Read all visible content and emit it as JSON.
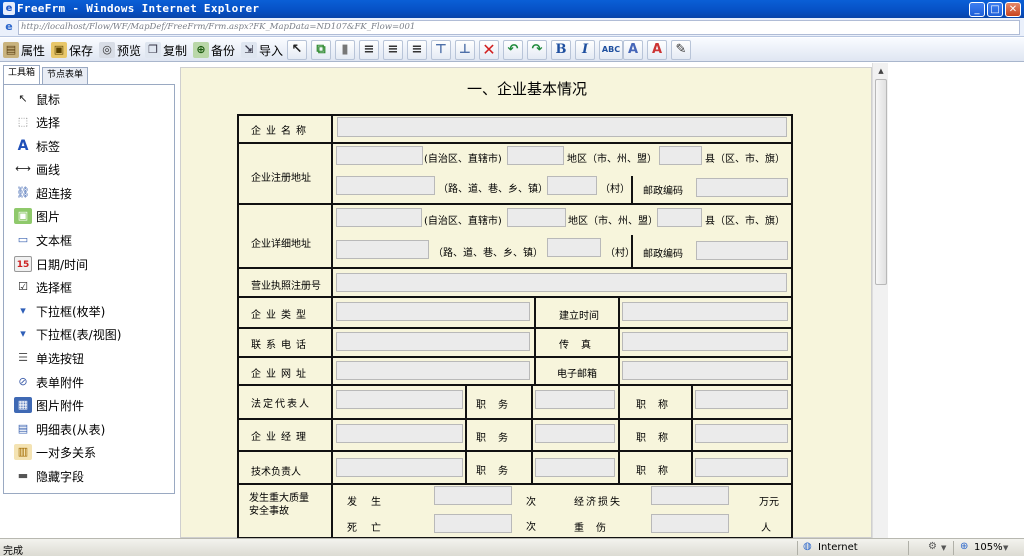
{
  "window": {
    "title": "FreeFrm - Windows Internet Explorer",
    "app_icon": "ie-icon",
    "buttons": {
      "minimize": "_",
      "maximize": "□",
      "close": "✕"
    }
  },
  "address": {
    "url": "http://localhost/Flow/WF/MapDef/FreeFrm/Frm.aspx?FK_MapData=ND107&FK_Flow=001"
  },
  "toolbar": {
    "properties": "属性",
    "save": "保存",
    "preview": "预览",
    "copy": "复制",
    "backup": "备份",
    "import": "导入",
    "icons": [
      "pointer-icon",
      "copy-format-icon",
      "paste-format-icon",
      "align-left-icon",
      "align-center-icon",
      "align-right-icon",
      "align-top-icon",
      "align-bottom-icon",
      "delete-icon",
      "undo-icon",
      "redo-icon",
      "bold-icon",
      "italic-icon",
      "font-icon",
      "font-color-icon",
      "fill-color-icon",
      "settings-icon"
    ]
  },
  "tabs": [
    "工具箱",
    "节点表单"
  ],
  "tools": [
    {
      "label": "鼠标",
      "icon": "cursor-icon"
    },
    {
      "label": "选择",
      "icon": "select-icon"
    },
    {
      "label": "标签",
      "icon": "label-icon"
    },
    {
      "label": "画线",
      "icon": "line-icon"
    },
    {
      "label": "超连接",
      "icon": "link-icon"
    },
    {
      "label": "图片",
      "icon": "image-icon"
    },
    {
      "label": "文本框",
      "icon": "textbox-icon"
    },
    {
      "label": "日期/时间",
      "icon": "calendar-icon"
    },
    {
      "label": "选择框",
      "icon": "checkbox-icon"
    },
    {
      "label": "下拉框(枚举)",
      "icon": "dropdown-icon"
    },
    {
      "label": "下拉框(表/视图)",
      "icon": "dropdown-table-icon"
    },
    {
      "label": "单选按钮",
      "icon": "radio-icon"
    },
    {
      "label": "表单附件",
      "icon": "attachment-icon"
    },
    {
      "label": "图片附件",
      "icon": "image-attachment-icon"
    },
    {
      "label": "明细表(从表)",
      "icon": "detail-table-icon"
    },
    {
      "label": "一对多关系",
      "icon": "one-to-many-icon"
    },
    {
      "label": "隐藏字段",
      "icon": "hidden-field-icon"
    }
  ],
  "form": {
    "title": "一、企业基本情况",
    "labels": {
      "company_name": "企业名称",
      "reg_address": "企业注册地址",
      "detail_address": "企业详细地址",
      "autonomous": "(自治区、直辖市)",
      "district": "地区（市、州、盟）",
      "county": "县（区、市、旗）",
      "road": "（路、道、巷、乡、镇）",
      "village": "（村）",
      "postcode": "邮政编码",
      "license": "营业执照注册号",
      "company_type": "企业类型",
      "established": "建立时间",
      "phone": "联系电话",
      "fax": "传真",
      "website": "企业网址",
      "email": "电子邮箱",
      "legal_rep": "法定代表人",
      "position": "职务",
      "title": "职称",
      "manager": "企业经理",
      "tech_lead": "技术负责人",
      "accident": "发生重大质量安全事故",
      "occur": "发生",
      "times": "次",
      "econ_loss": "经济损失",
      "wan_yuan": "万元",
      "death": "死亡",
      "injury": "重伤",
      "people": "人"
    }
  },
  "status": {
    "text": "完成",
    "zone": "Internet",
    "zoom": "105%"
  }
}
